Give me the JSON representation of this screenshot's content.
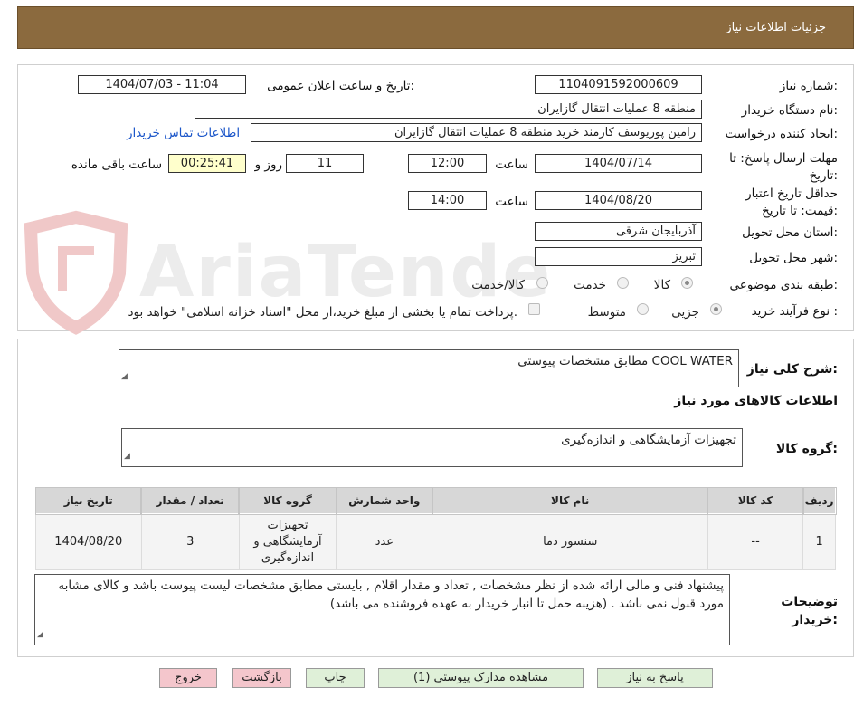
{
  "header": {
    "title": "جزئیات اطلاعات نیاز"
  },
  "form": {
    "need_number_label": "شماره نیاز:",
    "need_number": "1104091592000609",
    "announce_label": "تاریخ و ساعت اعلان عمومی:",
    "announce_value": "1404/07/03 - 11:04",
    "buyer_org_label": "نام دستگاه خریدار:",
    "buyer_org": "منطقه 8 عملیات انتقال گازایران",
    "creator_label": "ایجاد کننده درخواست:",
    "creator": "رامین پوریوسف کارمند خرید منطقه 8 عملیات انتقال گازایران",
    "contact_link": "اطلاعات تماس خریدار",
    "deadline_label": "مهلت ارسال پاسخ: تا تاریخ:",
    "deadline_date": "1404/07/14",
    "time_label": "ساعت",
    "deadline_time": "12:00",
    "days": "11",
    "days_label": "روز و",
    "remaining": "00:25:41",
    "remaining_label": "ساعت باقی مانده",
    "validity_label": "حداقل تاریخ اعتبار قیمت: تا تاریخ:",
    "validity_date": "1404/08/20",
    "validity_time": "14:00",
    "province_label": "استان محل تحویل:",
    "province": "آذربایجان شرقی",
    "city_label": "شهر محل تحویل:",
    "city": "تبریز",
    "category_label": "طبقه بندی موضوعی:",
    "category_options": [
      "کالا",
      "خدمت",
      "کالا/خدمت"
    ],
    "process_label": "نوع فرآیند خرید :",
    "process_options": [
      "جزیی",
      "متوسط"
    ],
    "payment_note": "پرداخت تمام یا بخشی از مبلغ خرید،از محل \"اسناد خزانه اسلامی\" خواهد بود."
  },
  "summary": {
    "label": "شرح کلی نیاز:",
    "value": "COOL WATER مطابق مشخصات پیوستی",
    "items_title": "اطلاعات کالاهای مورد نیاز",
    "group_label": "گروه کالا:",
    "group_value": "تجهیزات آزمایشگاهی و اندازه‌گیری"
  },
  "table": {
    "headers": [
      "ردیف",
      "کد کالا",
      "نام کالا",
      "واحد شمارش",
      "گروه کالا",
      "تعداد / مقدار",
      "تاریخ نیاز"
    ],
    "rows": [
      [
        "1",
        "--",
        "سنسور دما",
        "عدد",
        "تجهیزات آزمایشگاهی و اندازه‌گیری",
        "3",
        "1404/08/20"
      ]
    ]
  },
  "notes": {
    "label": "توضیحات خریدار:",
    "value": "پیشنهاد فنی و مالی ارائه شده از نظر مشخصات , تعداد و مقدار اقلام , بایستی مطابق مشخصات لیست پیوست باشد و کالای مشابه مورد قبول نمی باشد . (هزینه حمل تا انبار خریدار به عهده فروشنده می باشد)"
  },
  "buttons": {
    "respond": "پاسخ به نیاز",
    "attachments": "مشاهده مدارک پیوستی (1)",
    "print": "چاپ",
    "back": "بازگشت",
    "exit": "خروج"
  },
  "watermark": {
    "text": "AriaTender.net"
  },
  "colors": {
    "header": "#8b6a3e",
    "button_green": "#dff0d8",
    "button_pink": "#f4c6cc",
    "link": "#1a55c9"
  }
}
